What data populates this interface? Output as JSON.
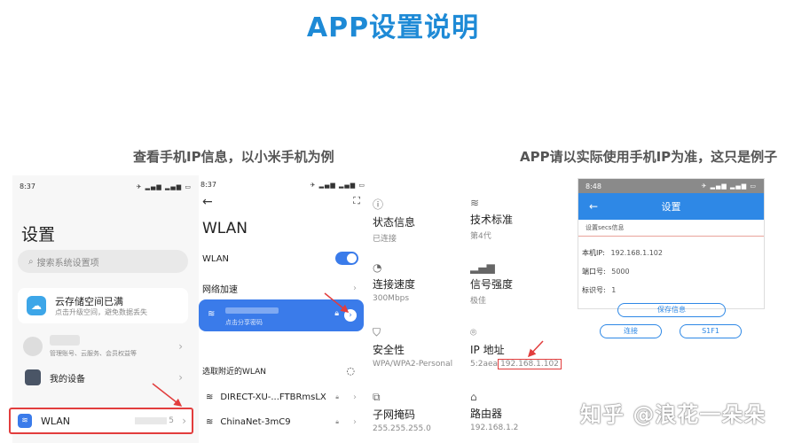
{
  "title": "APP设置说明",
  "captions": {
    "left": "查看手机IP信息，以小米手机为例",
    "right": "APP请以实际使用手机IP为准，这只是例子"
  },
  "panel1": {
    "time": "8:37",
    "status_icons": "✈ ▂▄▆ ▂▄▆ ▭",
    "heading": "设置",
    "search_placeholder": "搜索系统设置项",
    "cloud": {
      "title": "云存储空间已满",
      "subtitle": "点击升级空间，避免数据丢失"
    },
    "account_subtitle": "管理账号、云服务、会员权益等",
    "my_device": "我的设备",
    "wlan": {
      "label": "WLAN",
      "value": "5"
    }
  },
  "panel2": {
    "time": "8:37",
    "status_icons": "✈ ▂▄▆ ▂▄▆ ▭",
    "heading": "WLAN",
    "wlan_toggle_label": "WLAN",
    "accel": "网络加速",
    "connected_sub": "点击分享密码",
    "choose": "选取附近的WLAN",
    "networks": [
      "DIRECT-XU-...FTBRmsLX",
      "ChinaNet-3mC9"
    ]
  },
  "panel3": {
    "cells": [
      {
        "label": "状态信息",
        "value": "已连接",
        "icon": "info-icon"
      },
      {
        "label": "技术标准",
        "value": "第4代",
        "icon": "wifi-icon"
      },
      {
        "label": "连接速度",
        "value": "300Mbps",
        "icon": "speed-icon"
      },
      {
        "label": "信号强度",
        "value": "极佳",
        "icon": "signal-icon"
      },
      {
        "label": "安全性",
        "value": "WPA/WPA2-Personal",
        "icon": "shield-icon"
      },
      {
        "label": "IP 地址",
        "value_prefix": "5:2aea",
        "value": "192.168.1.102",
        "icon": "location-icon"
      },
      {
        "label": "子网掩码",
        "value": "255.255.255.0",
        "icon": "network-icon"
      },
      {
        "label": "路由器",
        "value": "192.168.1.2",
        "icon": "router-icon"
      }
    ]
  },
  "panel4": {
    "time": "8:48",
    "status_icons": "✈ ▂▄▆ ▂▄▆ ▭",
    "title": "设置",
    "subtitle": "设置secs信息",
    "fields": [
      {
        "label": "本机IP:",
        "value": "192.168.1.102"
      },
      {
        "label": "端口号:",
        "value": "5000"
      },
      {
        "label": "标识号:",
        "value": "1"
      }
    ],
    "save": "保存信息",
    "connect": "连接",
    "s1f1": "S1F1"
  },
  "watermark": "知乎 @浪花一朵朵",
  "colors": {
    "accent": "#1e8ad6",
    "highlight": "#e23d3d",
    "wlan_blue": "#3a7bea"
  }
}
